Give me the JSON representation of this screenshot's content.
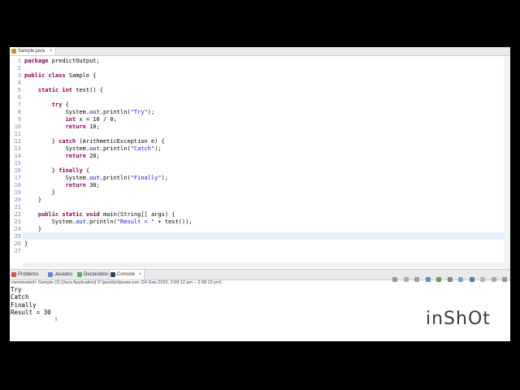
{
  "editor_tab": {
    "filename": "Sample.java",
    "close": "×"
  },
  "code_lines": [
    {
      "n": "1",
      "text": "package predictOutput;"
    },
    {
      "n": "2",
      "text": ""
    },
    {
      "n": "3",
      "text": "public class Sample {"
    },
    {
      "n": "4",
      "text": ""
    },
    {
      "n": "5",
      "text": "    static int test() {"
    },
    {
      "n": "6",
      "text": ""
    },
    {
      "n": "7",
      "text": "        try {"
    },
    {
      "n": "8",
      "text": "            System.out.println(\"Try\");"
    },
    {
      "n": "9",
      "text": "            int x = 10 / 0;"
    },
    {
      "n": "10",
      "text": "            return 10;"
    },
    {
      "n": "11",
      "text": ""
    },
    {
      "n": "12",
      "text": "        } catch (ArithmeticException e) {"
    },
    {
      "n": "13",
      "text": "            System.out.println(\"Catch\");"
    },
    {
      "n": "14",
      "text": "            return 20;"
    },
    {
      "n": "15",
      "text": ""
    },
    {
      "n": "16",
      "text": "        } finally {"
    },
    {
      "n": "17",
      "text": "            System.out.println(\"Finally\");"
    },
    {
      "n": "18",
      "text": "            return 30;"
    },
    {
      "n": "19",
      "text": "        }"
    },
    {
      "n": "20",
      "text": "    }"
    },
    {
      "n": "21",
      "text": ""
    },
    {
      "n": "22",
      "text": "    public static void main(String[] args) {"
    },
    {
      "n": "23",
      "text": "        System.out.println(\"Result = \" + test());"
    },
    {
      "n": "24",
      "text": "    }"
    },
    {
      "n": "25",
      "text": ""
    },
    {
      "n": "26",
      "text": "}"
    },
    {
      "n": "27",
      "text": ""
    }
  ],
  "console_tabs": {
    "problems": "Problems",
    "javadoc": "Javadoc",
    "declaration": "Declaration",
    "console": "Console",
    "console_close": "×"
  },
  "console_status": "<terminated> Sample (2) [Java Application] D:\\java\\bin\\javaw.exe  (24-Sep-2026, 2:08:12 pm – 2:08:13 pm)",
  "console_output": [
    "Try",
    "Catch",
    "Finally",
    "Result = 30"
  ],
  "watermark": "inShOt",
  "colors": {
    "keyword": "#7f0055",
    "string": "#2a00ff",
    "field": "#0000c0",
    "line_number": "#7a8aa8"
  }
}
